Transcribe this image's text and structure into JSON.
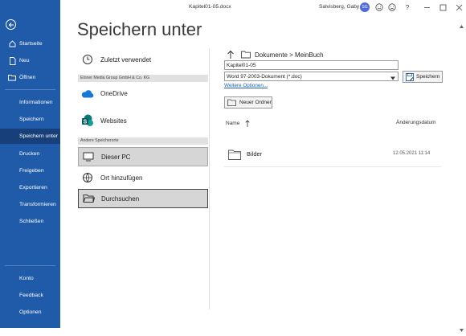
{
  "window": {
    "doc_title": "Kapitel01-05.docx",
    "user_name": "Salvisberg, Gaby",
    "avatar_initials": "SG",
    "help": "?"
  },
  "sidebar": {
    "nav_top": [
      {
        "label": "Startseite"
      },
      {
        "label": "Neu"
      },
      {
        "label": "Öffnen"
      }
    ],
    "nav_main": [
      {
        "label": "Informationen"
      },
      {
        "label": "Speichern"
      },
      {
        "label": "Speichern unter"
      },
      {
        "label": "Drucken"
      },
      {
        "label": "Freigeben"
      },
      {
        "label": "Exportieren"
      },
      {
        "label": "Transformieren"
      },
      {
        "label": "Schließen"
      }
    ],
    "nav_bottom": [
      {
        "label": "Konto"
      },
      {
        "label": "Feedback"
      },
      {
        "label": "Optionen"
      }
    ],
    "accent": "#1f5ba8"
  },
  "main": {
    "title": "Speichern unter",
    "recent_label": "Zuletzt verwendet",
    "org_header": "Eloner Media Group GmbH & Co. KG",
    "onedrive_label": "OneDrive",
    "websites_label": "Websites",
    "other_header": "Andere Speicherorte",
    "this_pc_label": "Dieser PC",
    "add_place_label": "Ort hinzufügen",
    "browse_label": "Durchsuchen"
  },
  "save_panel": {
    "breadcrumb": "Dokumente > MeinBuch",
    "filename_value": "Kapitel01-05",
    "filetype_value": "Word 97-2003-Dokument (*.doc)",
    "save_button": "Speichern",
    "more_options": "Weitere Optionen...",
    "new_folder": "Neuer Ordner",
    "col_name": "Name",
    "col_date": "Änderungsdatum",
    "files": [
      {
        "name": "Bilder",
        "date": "12.05.2021 11:14"
      }
    ]
  }
}
